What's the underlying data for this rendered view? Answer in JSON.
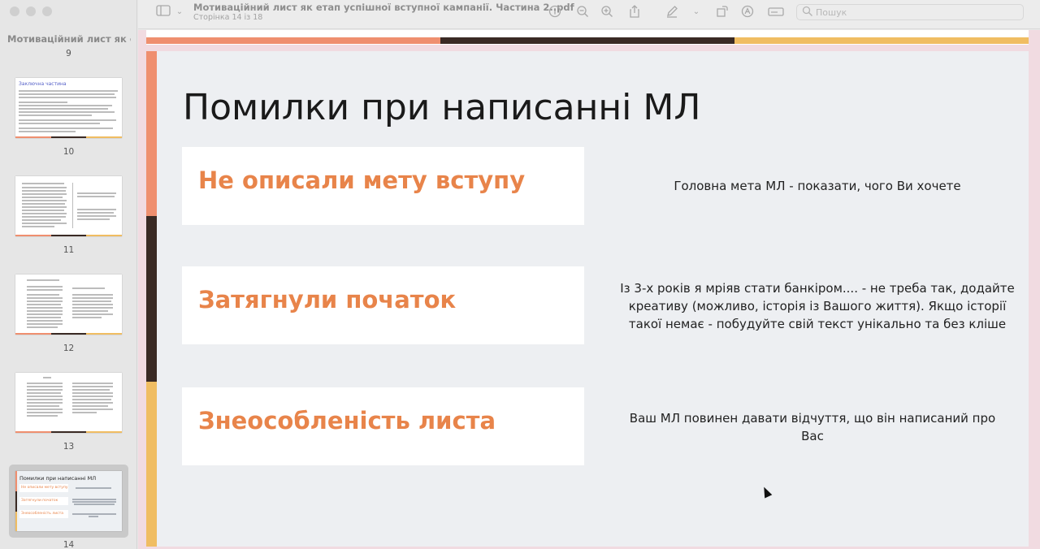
{
  "window": {
    "doc_title": "Мотиваційний лист як етап успішної вступної кампанії. Частина 2..pdf",
    "page_indicator": "Сторінка 14 із 18"
  },
  "sidebar": {
    "title": "Мотиваційний лист як е...",
    "pages": [
      {
        "number": "9"
      },
      {
        "number": "10",
        "heading": "Заключна частина"
      },
      {
        "number": "11"
      },
      {
        "number": "12"
      },
      {
        "number": "13"
      },
      {
        "number": "14",
        "heading": "Помилки при написанні МЛ",
        "selected": true
      }
    ]
  },
  "toolbar": {
    "search_placeholder": "Пошук",
    "icons": [
      "sidebar-toggle-icon",
      "info-icon",
      "zoom-out-icon",
      "zoom-in-icon",
      "share-icon",
      "markup-pen-icon",
      "rotate-icon",
      "annotate-icon",
      "form-icon",
      "search-icon"
    ]
  },
  "slide": {
    "title": "Помилки при написанні МЛ",
    "items": [
      {
        "label": "Не описали мету вступу",
        "description": "Головна мета МЛ - показати, чого Ви хочете"
      },
      {
        "label": "Затягнули початок",
        "description": "Із 3-х років я мріяв стати банкіром.... - не треба так, додайте креативу (можливо, історія із Вашого життя). Якщо історії такої немає - побудуйте свій текст унікально та без кліше"
      },
      {
        "label": "Знеособленість листа",
        "description": "Ваш МЛ повинен давати відчуття, що він написаний про Вас"
      }
    ]
  },
  "colors": {
    "accent_orange": "#e8844a",
    "stripe_salmon": "#ef8f6f",
    "stripe_dark": "#3a2a24",
    "stripe_yellow": "#f0bd62",
    "slide_bg": "#edeff2"
  }
}
